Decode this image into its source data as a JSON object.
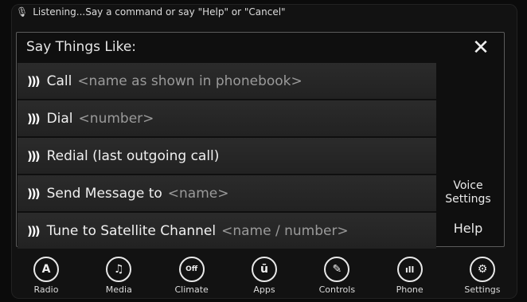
{
  "status": {
    "mic_icon": "microphone-icon",
    "text": "Listening...Say a command or say \"Help\" or \"Cancel\""
  },
  "panel": {
    "title": "Say Things Like:",
    "close_label": "✕",
    "rows": [
      {
        "cmd": "Call",
        "hint": "<name as shown in phonebook>"
      },
      {
        "cmd": "Dial",
        "hint": "<number>"
      },
      {
        "cmd": "Redial (last outgoing call)",
        "hint": ""
      },
      {
        "cmd": "Send Message to",
        "hint": "<name>"
      },
      {
        "cmd": "Tune to Satellite Channel",
        "hint": "<name / number>"
      }
    ]
  },
  "side": {
    "voice_settings_line1": "Voice",
    "voice_settings_line2": "Settings",
    "help": "Help"
  },
  "dock": [
    {
      "label": "Radio",
      "icon": "radio-icon",
      "glyph": "A"
    },
    {
      "label": "Media",
      "icon": "music-note-icon",
      "glyph": "♫"
    },
    {
      "label": "Climate",
      "icon": "climate-off-icon",
      "glyph": "Off"
    },
    {
      "label": "Apps",
      "icon": "apps-icon",
      "glyph": "ū"
    },
    {
      "label": "Controls",
      "icon": "wrench-icon",
      "glyph": "✎"
    },
    {
      "label": "Phone",
      "icon": "phone-signal-icon",
      "glyph": "ıll"
    },
    {
      "label": "Settings",
      "icon": "gear-icon",
      "glyph": "⚙"
    }
  ]
}
